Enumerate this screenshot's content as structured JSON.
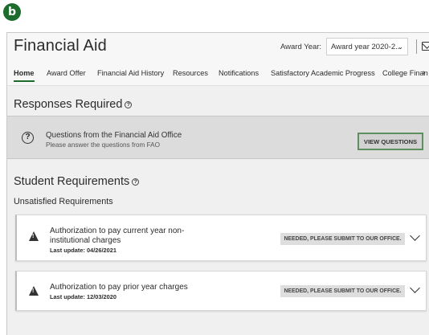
{
  "figure_label": "b",
  "app": {
    "title": "Financial Aid"
  },
  "award_year": {
    "label": "Award Year:",
    "selected": "Award year 2020-2..."
  },
  "tabs": [
    {
      "label": "Home",
      "active": true
    },
    {
      "label": "Award Offer"
    },
    {
      "label": "Financial Aid History"
    },
    {
      "label": "Resources"
    },
    {
      "label": "Notifications"
    },
    {
      "label": "Satisfactory Academic Progress"
    },
    {
      "label": "College Finan"
    }
  ],
  "responses": {
    "title": "Responses Required",
    "item_title": "Questions from the Financial Aid Office",
    "item_subtitle": "Please answer the questions from FAO",
    "button": "VIEW QUESTIONS"
  },
  "requirements": {
    "title": "Student Requirements",
    "subtitle": "Unsatisfied Requirements",
    "items": [
      {
        "title": "Authorization to pay current year non-institutional charges",
        "date": "Last update: 04/26/2021",
        "status": "NEEDED, PLEASE SUBMIT TO OUR OFFICE."
      },
      {
        "title": "Authorization to pay prior year charges",
        "date": "Last update: 12/03/2020",
        "status": "NEEDED, PLEASE SUBMIT TO OUR OFFICE."
      }
    ]
  },
  "colors": {
    "accent": "#1e6b2e",
    "panel": "#dcdcdc",
    "background": "#f0f0f0"
  },
  "icons": [
    "help-icon",
    "question-icon",
    "warning-icon",
    "chevron-down-icon",
    "mail-icon"
  ]
}
